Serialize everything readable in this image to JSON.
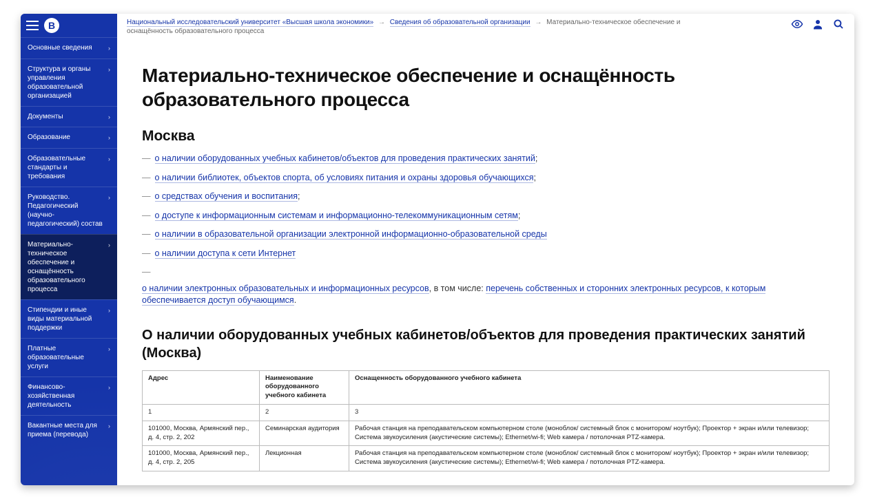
{
  "breadcrumbs": {
    "root": "Национальный исследовательский университет «Высшая школа экономики»",
    "mid": "Сведения об образовательной организации",
    "current": "Материально-техническое обеспечение и оснащённость образовательного процесса"
  },
  "sidebar": {
    "items": [
      {
        "label": "Основные сведения",
        "active": false
      },
      {
        "label": "Структура и органы управления образовательной организацией",
        "active": false
      },
      {
        "label": "Документы",
        "active": false
      },
      {
        "label": "Образование",
        "active": false
      },
      {
        "label": "Образовательные стандарты и требования",
        "active": false
      },
      {
        "label": "Руководство. Педагогический (научно-педагогический) состав",
        "active": false
      },
      {
        "label": "Материально-техническое обеспечение и оснащённость образовательного процесса",
        "active": true
      },
      {
        "label": "Стипендии и иные виды материальной поддержки",
        "active": false
      },
      {
        "label": "Платные образовательные услуги",
        "active": false
      },
      {
        "label": "Финансово-хозяйственная деятельность",
        "active": false
      },
      {
        "label": "Вакантные места для приема (перевода)",
        "active": false
      }
    ]
  },
  "page": {
    "title": "Материально-техническое обеспечение и оснащённость образовательного процесса",
    "city": "Москва"
  },
  "links": [
    {
      "text": "о наличии оборудованных учебных кабинетов/объектов для проведения практических занятий",
      "suffix": ";"
    },
    {
      "text": "о наличии библиотек, объектов спорта, об условиях питания и охраны здоровья обучающихся",
      "suffix": ";"
    },
    {
      "text": "о средствах обучения и воспитания",
      "suffix": ";"
    },
    {
      "text": "о доступе к информационным системам и информационно-телекоммуникационным сетям",
      "suffix": ";"
    },
    {
      "text": "о наличии в образовательной организации электронной информационно-образовательной среды",
      "suffix": ""
    },
    {
      "text": "о наличии доступа к сети Интернет",
      "suffix": ""
    },
    {
      "text": "о наличии электронных образовательных и информационных ресурсов",
      "suffix": "",
      "tail_plain": ", в том числе: ",
      "tail_link": "перечень собственных и сторонних электронных ресурсов, к которым обеспечивается доступ обучающимся",
      "tail_end": "."
    }
  ],
  "section2_title": "О наличии оборудованных учебных кабинетов/объектов для проведения практических занятий (Москва)",
  "table": {
    "headers": [
      "Адрес",
      "Наименование оборудованного учебного кабинета",
      "Оснащенность оборудованного учебного кабинета"
    ],
    "colnums": [
      "1",
      "2",
      "3"
    ],
    "rows": [
      {
        "addr": "101000, Москва, Армянский пер., д. 4, стр. 2, 202",
        "name": "Семинарская аудитория",
        "desc": "Рабочая станция на преподавательском компьютерном столе (моноблок/ системный блок с монитором/ ноутбук); Проектор + экран и/или телевизор; Система звукоусиления (акустические системы); Ethernet/wi-fi; Web камера / потолочная PTZ-камера."
      },
      {
        "addr": "101000, Москва, Армянский пер., д. 4, стр. 2, 205",
        "name": "Лекционная",
        "desc": "Рабочая станция на преподавательском компьютерном столе (моноблок/ системный блок с монитором/ ноутбук); Проектор + экран и/или телевизор; Система звукоусиления (акустические системы); Ethernet/wi-fi; Web камера / потолочная PTZ-камера."
      }
    ]
  },
  "logo_letter": "В"
}
